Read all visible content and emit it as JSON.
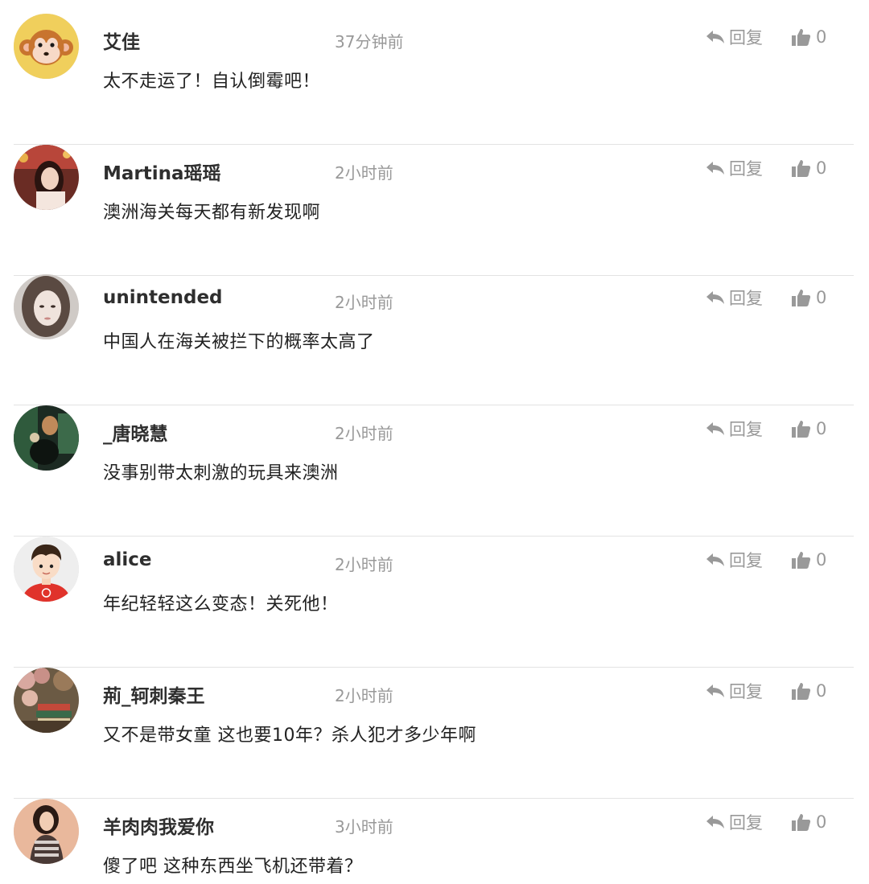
{
  "comments": [
    {
      "username": "艾佳",
      "time": "37分钟前",
      "reply_label": "回复",
      "like_count": "0",
      "content": "太不走运了！自认倒霉吧！",
      "avatar_icon": "monkey-cartoon"
    },
    {
      "username": "Martina瑶瑶",
      "time": "2小时前",
      "reply_label": "回复",
      "like_count": "0",
      "content": "澳洲海关每天都有新发现啊",
      "avatar_icon": "user-photo"
    },
    {
      "username": "unintended",
      "time": "2小时前",
      "reply_label": "回复",
      "like_count": "0",
      "content": "中国人在海关被拦下的概率太高了",
      "avatar_icon": "user-photo"
    },
    {
      "username": "_唐晓慧",
      "time": "2小时前",
      "reply_label": "回复",
      "like_count": "0",
      "content": "没事别带太刺激的玩具来澳洲",
      "avatar_icon": "user-photo"
    },
    {
      "username": "alice",
      "time": "2小时前",
      "reply_label": "回复",
      "like_count": "0",
      "content": "年纪轻轻这么变态！关死他！",
      "avatar_icon": "boy-cartoon"
    },
    {
      "username": "荊_轲刺秦王",
      "time": "2小时前",
      "reply_label": "回复",
      "like_count": "0",
      "content": "又不是带女童 这也要10年？杀人犯才多少年啊",
      "avatar_icon": "user-photo"
    },
    {
      "username": "羊肉肉我爱你",
      "time": "3小时前",
      "reply_label": "回复",
      "like_count": "0",
      "content": "傻了吧 这种东西坐飞机还带着？",
      "avatar_icon": "user-photo"
    }
  ],
  "colors": {
    "meta_gray": "#999999",
    "divider": "#e3e3e3",
    "monkey_bg": "#f3d36a"
  }
}
